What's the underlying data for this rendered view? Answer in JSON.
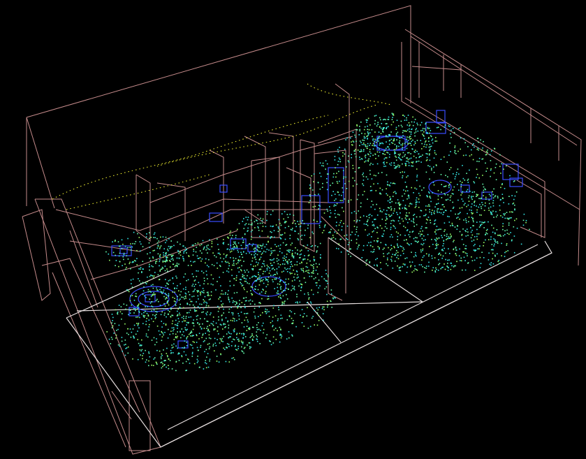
{
  "viewport": {
    "background": "#000000",
    "colors": {
      "wall_wireframe": "#c58b8b",
      "floor_wireframe": "#e6dede",
      "object_box": "#3a4cff",
      "streamline_low": "#ffff33",
      "streamline_mid": "#66ffb0",
      "streamline_high": "#33e6e6"
    }
  }
}
